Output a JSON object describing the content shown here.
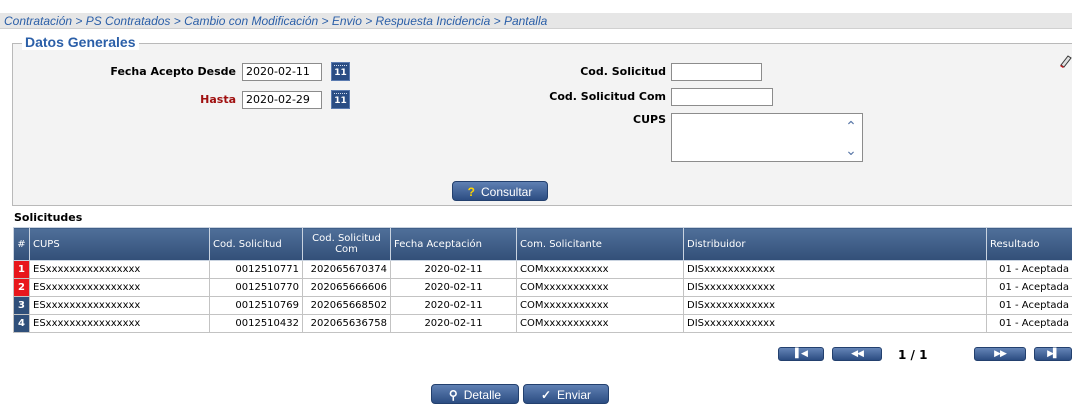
{
  "breadcrumb": "Contratación > PS Contratados > Cambio con Modificación > Envio > Respuesta Incidencia > Pantalla",
  "datos_generales": {
    "title": "Datos Generales",
    "fecha_desde_label": "Fecha Acepto Desde",
    "fecha_desde_value": "2020-02-11",
    "hasta_label": "Hasta",
    "hasta_value": "2020-02-29",
    "calendar_icon_text": "11",
    "cod_solicitud_label": "Cod. Solicitud",
    "cod_solicitud_value": "",
    "cod_solicitud_com_label": "Cod. Solicitud Com",
    "cod_solicitud_com_value": "",
    "cups_label": "CUPS",
    "cups_value": "",
    "consultar_label": "Consultar",
    "consultar_icon": "?",
    "eraser_icon": "eraser-icon"
  },
  "solicitudes": {
    "title": "Solicitudes",
    "headers": [
      "#",
      "CUPS",
      "Cod. Solicitud",
      "Cod. Solicitud Com",
      "Fecha Aceptación",
      "Com. Solicitante",
      "Distribuidor",
      "Resultado"
    ],
    "rows": [
      {
        "n": "1",
        "cups": "ESxxxxxxxxxxxxxxxx",
        "cod": "0012510771",
        "cod_com": "202065670374",
        "fecha": "2020-02-11",
        "com": "COMxxxxxxxxxxx",
        "dist": "DISxxxxxxxxxxxx",
        "resultado": "01 - Aceptada"
      },
      {
        "n": "2",
        "cups": "ESxxxxxxxxxxxxxxxx",
        "cod": "0012510770",
        "cod_com": "202065666606",
        "fecha": "2020-02-11",
        "com": "COMxxxxxxxxxxx",
        "dist": "DISxxxxxxxxxxxx",
        "resultado": "01 - Aceptada"
      },
      {
        "n": "3",
        "cups": "ESxxxxxxxxxxxxxxxx",
        "cod": "0012510769",
        "cod_com": "202065668502",
        "fecha": "2020-02-11",
        "com": "COMxxxxxxxxxxx",
        "dist": "DISxxxxxxxxxxxx",
        "resultado": "01 - Aceptada"
      },
      {
        "n": "4",
        "cups": "ESxxxxxxxxxxxxxxxx",
        "cod": "0012510432",
        "cod_com": "202065636758",
        "fecha": "2020-02-11",
        "com": "COMxxxxxxxxxxx",
        "dist": "DISxxxxxxxxxxxx",
        "resultado": "01 - Aceptada"
      }
    ],
    "row_number_colors": [
      "#e8171c",
      "#e8171c",
      "#2f4f7a",
      "#2f4f7a"
    ]
  },
  "pagination": {
    "label": "1 / 1",
    "first_icon": "first-page-icon",
    "prev_icon": "previous-page-icon",
    "next_icon": "next-page-icon",
    "last_icon": "last-page-icon"
  },
  "actions": {
    "detalle_label": "Detalle",
    "enviar_label": "Enviar",
    "detalle_icon": "magnifier-icon",
    "enviar_icon": "checkmark-icon"
  },
  "colors": {
    "accent": "#2b5fa8",
    "header_bg": "#324f78",
    "required_label": "#a01010",
    "row_marker_red": "#e8171c"
  }
}
